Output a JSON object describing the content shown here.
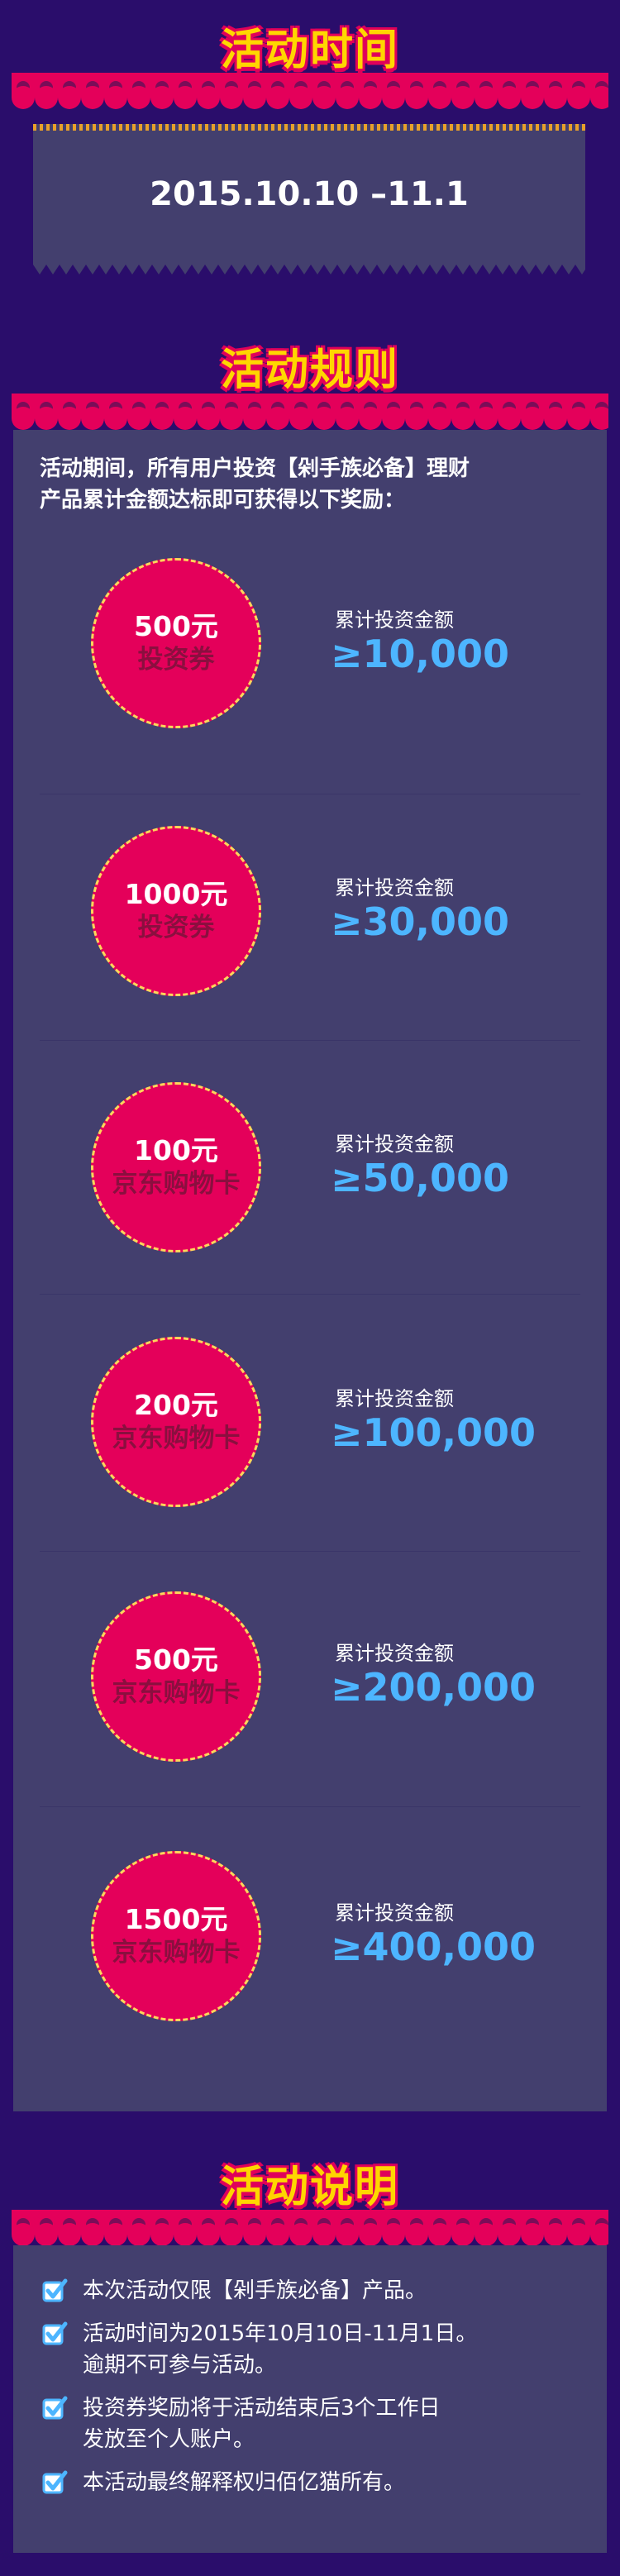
{
  "sections": {
    "time_title": "活动时间",
    "rules_title": "活动规则",
    "notes_title": "活动说明"
  },
  "time": {
    "date_range": "2015.10.10 –11.1"
  },
  "rules": {
    "intro_line1": "活动期间，所有用户投资【剁手族必备】理财",
    "intro_line2": "产品累计金额达标即可获得以下奖励：",
    "cond_label": "累计投资金额",
    "rewards": [
      {
        "amount": "500元",
        "type": "投资券",
        "threshold": "≥10,000"
      },
      {
        "amount": "1000元",
        "type": "投资券",
        "threshold": "≥30,000"
      },
      {
        "amount": "100元",
        "type": "京东购物卡",
        "threshold": "≥50,000"
      },
      {
        "amount": "200元",
        "type": "京东购物卡",
        "threshold": "≥100,000"
      },
      {
        "amount": "500元",
        "type": "京东购物卡",
        "threshold": "≥200,000"
      },
      {
        "amount": "1500元",
        "type": "京东购物卡",
        "threshold": "≥400,000"
      }
    ]
  },
  "notes": [
    {
      "lines": [
        "本次活动仅限【剁手族必备】产品。"
      ]
    },
    {
      "lines": [
        "活动时间为2015年10月10日-11月1日。",
        "逾期不可参与活动。"
      ]
    },
    {
      "lines": [
        "投资券奖励将于活动结束后3个工作日",
        "发放至个人账户。"
      ]
    },
    {
      "lines": [
        "本活动最终解释权归佰亿猫所有。"
      ]
    }
  ],
  "colors": {
    "background": "#2a0d6b",
    "panel": "#433f6e",
    "awning": "#e4005a",
    "title": "#ffd600",
    "threshold": "#4db5ff",
    "badge": "#e4005a"
  },
  "icons": {
    "note_check": "checkbox-checked-icon"
  }
}
